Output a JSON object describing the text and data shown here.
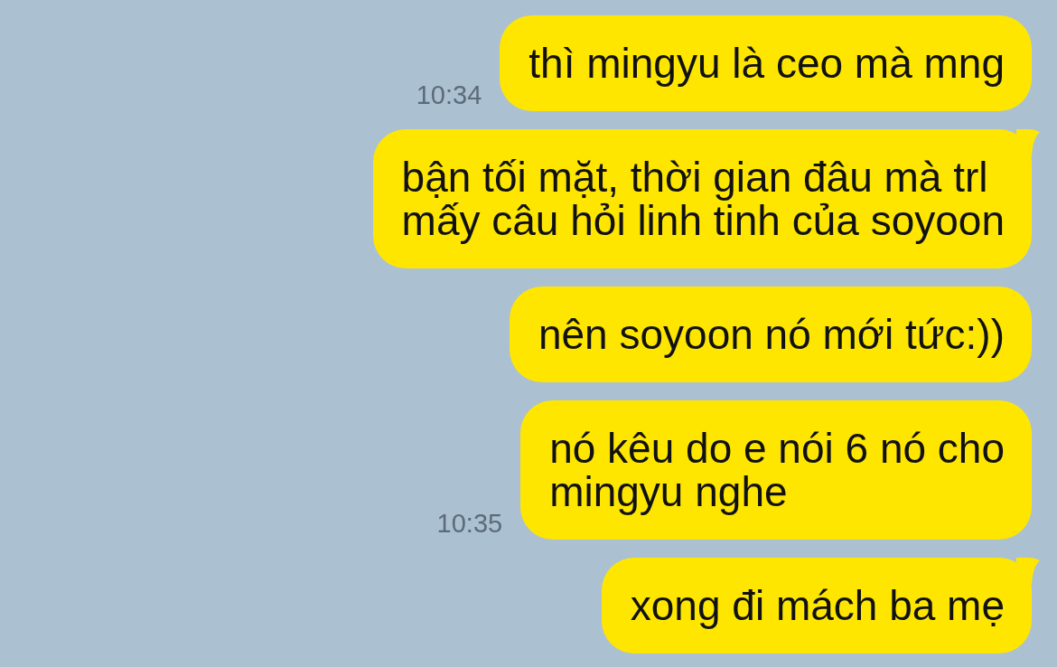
{
  "messages": [
    {
      "text": "thì mingyu là ceo mà mng",
      "time": "10:34",
      "tail": false
    },
    {
      "text": "bận tối mặt, thời gian đâu mà trl\nmấy câu hỏi linh tinh của soyoon",
      "tail": true
    },
    {
      "text": "nên soyoon nó mới tức:))",
      "tail": false
    },
    {
      "text": "nó kêu do e nói 6 nó cho\nmingyu nghe",
      "time": "10:35",
      "tail": false
    },
    {
      "text": "xong đi mách ba mẹ",
      "tail": true
    }
  ]
}
